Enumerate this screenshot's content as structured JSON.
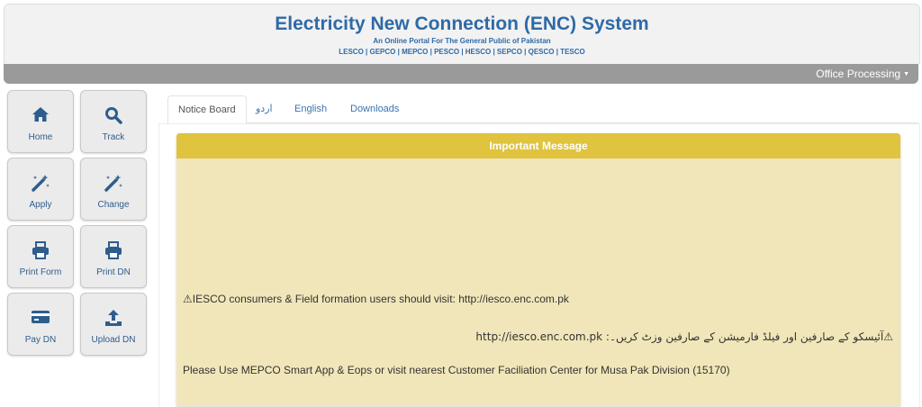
{
  "header": {
    "title": "Electricity New Connection (ENC) System",
    "subtitle": "An Online Portal For The General Public of Pakistan",
    "companies": "LESCO | GEPCO | MEPCO | PESCO | HESCO | SEPCO | QESCO | TESCO"
  },
  "navbar": {
    "menu_label": "Office Processing"
  },
  "sidebar": {
    "tiles": [
      {
        "label": "Home",
        "icon": "home-icon"
      },
      {
        "label": "Track",
        "icon": "search-icon"
      },
      {
        "label": "Apply",
        "icon": "magic-wand-icon"
      },
      {
        "label": "Change",
        "icon": "magic-wand-icon"
      },
      {
        "label": "Print Form",
        "icon": "printer-icon"
      },
      {
        "label": "Print DN",
        "icon": "printer-icon"
      },
      {
        "label": "Pay DN",
        "icon": "credit-card-icon"
      },
      {
        "label": "Upload DN",
        "icon": "upload-icon"
      }
    ]
  },
  "tabs": [
    "Notice Board",
    "اردو",
    "English",
    "Downloads"
  ],
  "notice": {
    "heading": "Important Message",
    "line1": "⚠IESCO consumers & Field formation users should visit: http://iesco.enc.com.pk",
    "line2": "⚠آئیسکو کے صارفین اور فیلڈ فارمیشن کے صارفین وزٹ کریں۔: http://iesco.enc.com.pk",
    "line3": "Please Use MEPCO Smart App & Eops or visit nearest Customer Faciliation Center for Musa Pak Division (15170)"
  },
  "colors": {
    "brand": "#2e6aa7",
    "navbar": "#9a9a9a",
    "notice_header": "#e0c33e",
    "notice_body": "#f1e6b9"
  }
}
